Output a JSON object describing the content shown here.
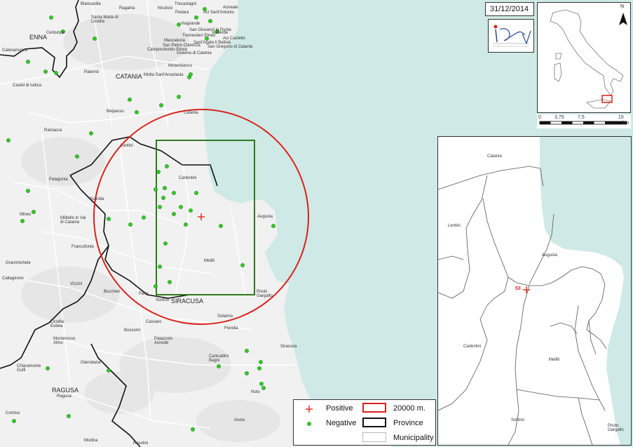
{
  "date": "31/12/2014",
  "logo": {
    "text": "IZS Sicilia"
  },
  "north_arrow": {
    "label": "N"
  },
  "scale_bar": {
    "ticks": [
      "0",
      "3,75",
      "7,5",
      "",
      "15"
    ],
    "unit": "km"
  },
  "colors": {
    "sea": "#cfe9e6",
    "land": "#f1f1f1",
    "positive": "#e2231a",
    "negative": "#2fce23",
    "buffer": "#d9221c",
    "zone": "#2f7a1d",
    "province": "#111111"
  },
  "main_map": {
    "provinces": [
      "ENNA",
      "CATANIA",
      "SIRACUSA",
      "RAGUSA"
    ],
    "places": [
      "Biancavilla",
      "Ragalna",
      "Nicolosi",
      "Trecastagni",
      "Aci Sant'Antonio",
      "Acireale",
      "Santa Maria di Licodia",
      "Pedara",
      "Viagrande",
      "Mascalucia",
      "Tremestieri Etneo",
      "San Giovanni la Punta",
      "Sant'Agata li Battiati",
      "San Gregorio di Catania",
      "Aci Castello",
      "Camporotondo Etneo",
      "San Pietro Clarenza",
      "Gravina di Catania",
      "Misterbianco",
      "Valverde",
      "Motta Sant'Anastasia",
      "Centuripe",
      "Catenanuova",
      "Castel di Iudica",
      "Paternò",
      "Belpasso",
      "Catania",
      "Ramacca",
      "Lentini",
      "Palagonia",
      "Scordia",
      "Carlentini",
      "Augusta",
      "Mineo",
      "Militello in Val di Catania",
      "Francofonte",
      "Grammichele",
      "Melilli",
      "Vizzini",
      "Buccheri",
      "Ferla",
      "Sortino",
      "Priolo Gargallo",
      "Caltagirone",
      "Licodia Eubea",
      "Solarino",
      "Cassaro",
      "Buscemi",
      "Floridia",
      "Palazzolo Acreide",
      "Monterosso Almo",
      "Canicattini Bagni",
      "Siracusa",
      "Giarratana",
      "Chiaramonte Gulfi",
      "Ragusa",
      "Noto",
      "Comiso",
      "Avola",
      "Modica",
      "Rosolini"
    ],
    "buffer_label": "20000 m."
  },
  "inset_map": {
    "places": [
      "Catania",
      "Lentini",
      "Augusta",
      "Carlentini",
      "Melilli",
      "Sortino",
      "Priolo Gargallo"
    ],
    "outbreak_id": "53"
  },
  "legend": {
    "positive": "Positive",
    "negative": "Negative",
    "buffer": "20000 m.",
    "province": "Province",
    "municipality": "Municipality"
  }
}
